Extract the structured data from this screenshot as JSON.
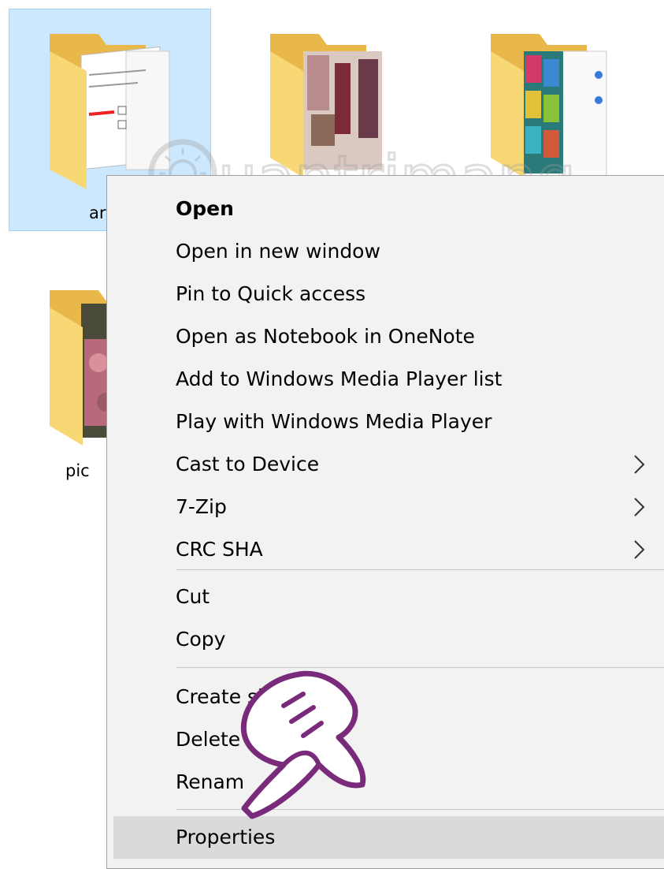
{
  "files": [
    {
      "name": "folder-ar",
      "label": "ar"
    },
    {
      "name": "folder-people",
      "label": ""
    },
    {
      "name": "folder-colors",
      "label": ""
    },
    {
      "name": "folder-pic",
      "label": "pic"
    }
  ],
  "watermark": "Quantrimang",
  "menu": {
    "items": [
      {
        "label": "Open",
        "bold": true
      },
      {
        "label": "Open in new window"
      },
      {
        "label": "Pin to Quick access"
      },
      {
        "label": "Open as Notebook in OneNote"
      },
      {
        "label": "Add to Windows Media Player list"
      },
      {
        "label": "Play with Windows Media Player"
      },
      {
        "label": "Cast to Device",
        "submenu": true
      },
      {
        "label": "7-Zip",
        "submenu": true
      },
      {
        "label": "CRC SHA",
        "submenu": true
      },
      {
        "label": "Cut"
      },
      {
        "label": "Copy"
      },
      {
        "label": "Create sh"
      },
      {
        "label": "Delete"
      },
      {
        "label": "Renam"
      },
      {
        "label": "Properties",
        "highlighted": true
      }
    ]
  },
  "colors": {
    "selection": "#cce8ff",
    "menu_bg": "#f2f2f2",
    "hover": "#dadada",
    "folder": "#f8d775"
  }
}
